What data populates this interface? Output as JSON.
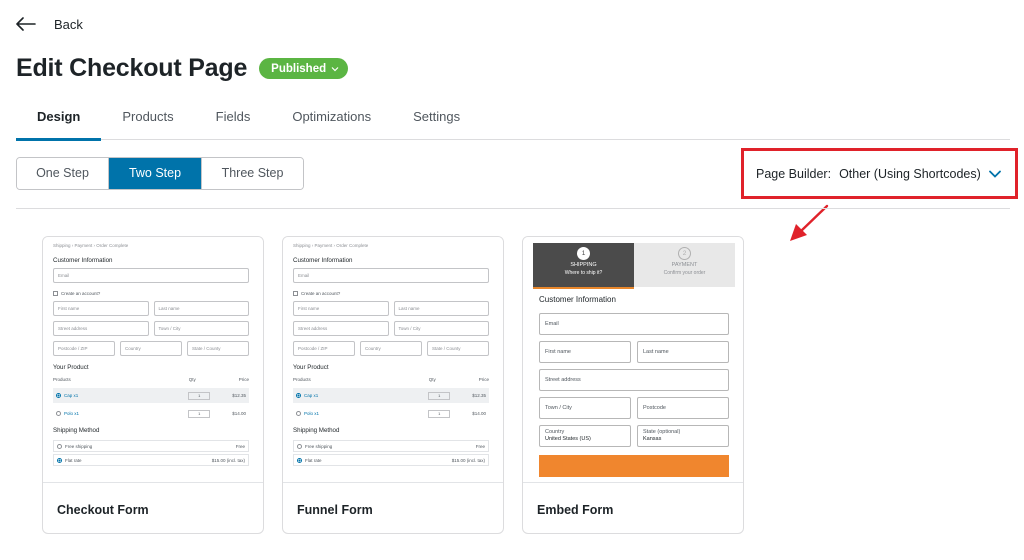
{
  "header": {
    "back_label": "Back"
  },
  "page": {
    "title": "Edit Checkout Page",
    "status": "Published"
  },
  "tabs": [
    {
      "label": "Design",
      "active": true
    },
    {
      "label": "Products"
    },
    {
      "label": "Fields"
    },
    {
      "label": "Optimizations"
    },
    {
      "label": "Settings"
    }
  ],
  "steps": [
    {
      "label": "One Step"
    },
    {
      "label": "Two Step",
      "active": true
    },
    {
      "label": "Three Step"
    }
  ],
  "page_builder": {
    "label": "Page Builder:",
    "value": "Other (Using Shortcodes)"
  },
  "colors": {
    "accent": "#0073aa",
    "status": "#5bb543",
    "highlight": "#e0222a",
    "embed_cta": "#f0862e"
  },
  "templates": [
    {
      "name": "Checkout Form"
    },
    {
      "name": "Funnel Form"
    },
    {
      "name": "Embed Form"
    }
  ],
  "mini_form": {
    "breadcrumb": "Shipping  ›  Payment  ›  Order Complete",
    "customer_heading": "Customer Information",
    "email": "Email",
    "create_account": "Create an account?",
    "first_name": "First name",
    "last_name": "Last name",
    "street": "Street address",
    "town": "Town / City",
    "postcode": "Postcode / ZIP",
    "country": "Country",
    "state": "State / County",
    "product_heading": "Your Product",
    "col_products": "Products",
    "col_qty": "Qty",
    "col_price": "Price",
    "product1": "Cap x1",
    "product1_qty": "1",
    "product1_price": "$12.35",
    "product2": "Polo x1",
    "product2_qty": "1",
    "product2_price": "$14.00",
    "shipping_heading": "Shipping Method",
    "ship1": "Free shipping",
    "ship1_price": "Free",
    "ship2": "Flat rate",
    "ship2_price": "$15.00 (incl. tax)"
  },
  "embed_form": {
    "step1_num": "1",
    "step1_title": "SHIPPING",
    "step1_sub": "Where to ship it?",
    "step2_num": "2",
    "step2_title": "PAYMENT",
    "step2_sub": "Confirm your order",
    "heading": "Customer Information",
    "email": "Email",
    "first_name": "First name",
    "last_name": "Last name",
    "street": "Street address",
    "town": "Town / City",
    "postcode": "Postcode",
    "country_label": "Country",
    "country_value": "United States (US)",
    "state_label": "State (optional)",
    "state_value": "Kansas"
  }
}
